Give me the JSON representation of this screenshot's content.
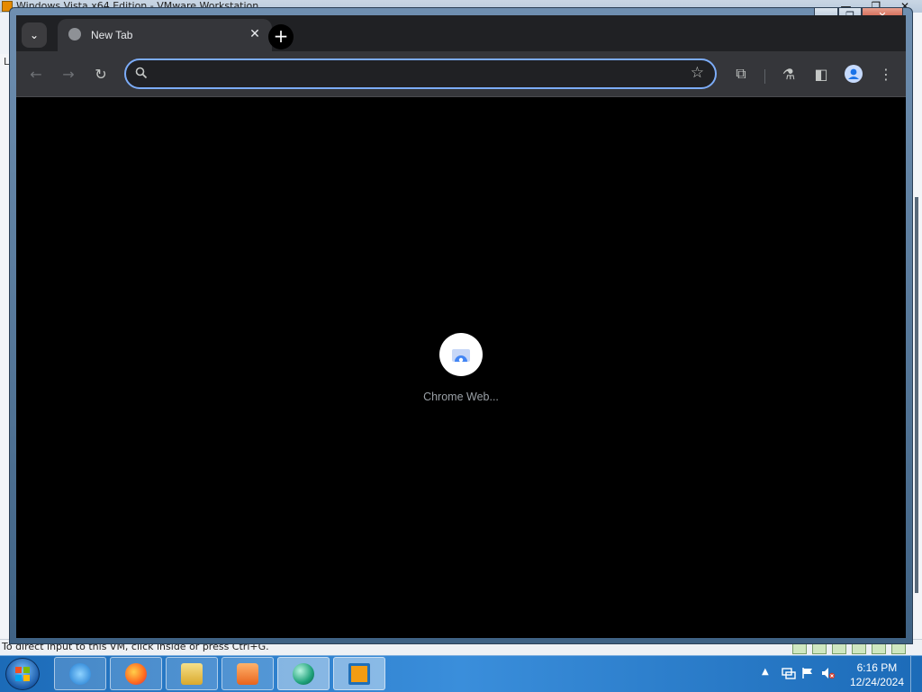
{
  "host": {
    "window_title": "Windows Vista x64 Edition - VMware Workstation",
    "side_label": "Li",
    "status_text": "To direct input to this VM, click inside or press Ctrl+G."
  },
  "window_controls": {
    "minimize": "—",
    "maximize": "❐",
    "close": "✕"
  },
  "browser": {
    "tabs": [
      {
        "title": "New Tab",
        "close": "✕",
        "favicon": "globe-icon"
      }
    ],
    "new_tab": "+",
    "tab_search": "⌄",
    "omnibox": {
      "value": "",
      "placeholder": ""
    },
    "toolbar_icons": [
      "back-icon",
      "forward-icon",
      "reload-icon",
      "bookmark-star-icon",
      "extensions-icon",
      "labs-icon",
      "side-panel-icon",
      "profile-icon",
      "menu-icon"
    ],
    "glyphs": {
      "back": "←",
      "forward": "→",
      "reload": "↻",
      "star": "☆",
      "extensions": "⧉",
      "labs": "⚗",
      "side_panel": "◧",
      "menu": "⋮"
    }
  },
  "content": {
    "shortcut_tile": {
      "label": "Chrome Web...",
      "icon": "chrome-web-store-icon"
    }
  },
  "taskbar": {
    "apps": [
      "internet-explorer-icon",
      "firefox-icon",
      "file-explorer-icon",
      "media-player-icon",
      "app-sphere-icon",
      "vmware-icon"
    ],
    "clock": {
      "time": "6:16 PM",
      "date": "12/24/2024"
    },
    "tray_up": "▲"
  },
  "colors": {
    "accent": "#7cacf8",
    "tab_strip": "#202124",
    "toolbar": "#35363a",
    "content_bg": "#000000"
  }
}
